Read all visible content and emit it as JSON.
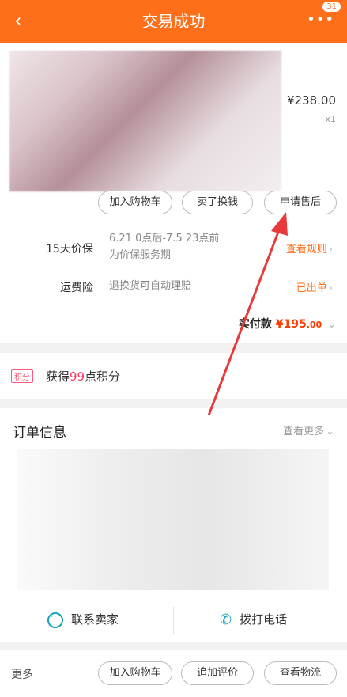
{
  "header": {
    "back_icon": "‹",
    "title": "交易成功",
    "more_icon": "•••",
    "badge": "31"
  },
  "product": {
    "price": "¥238.00",
    "qty": "x1"
  },
  "product_actions": {
    "add_cart": "加入购物车",
    "resell": "卖了换钱",
    "after_sale": "申请售后"
  },
  "guarantee": {
    "label": "15天价保",
    "text_line1": "6.21 0点后-7.5 23点前",
    "text_line2": "为价保服务期",
    "link": "查看规则"
  },
  "shipping_insurance": {
    "label": "运费险",
    "text": "退换货可自动理赔",
    "link": "已出单"
  },
  "payment": {
    "label": "实付款",
    "currency": "¥",
    "amount": "195",
    "decimals": ".00"
  },
  "points": {
    "tag": "积分",
    "prefix": "获得",
    "number": "99",
    "suffix": "点积分"
  },
  "order_info": {
    "title": "订单信息",
    "more": "查看更多"
  },
  "contact": {
    "seller": "联系卖家",
    "call": "拨打电话"
  },
  "footer": {
    "more": "更多",
    "add_cart": "加入购物车",
    "review": "追加评价",
    "logistics": "查看物流"
  },
  "colors": {
    "accent": "#ff6f1a",
    "arrow": "#e83a3a",
    "icon": "#1aa3b8"
  }
}
